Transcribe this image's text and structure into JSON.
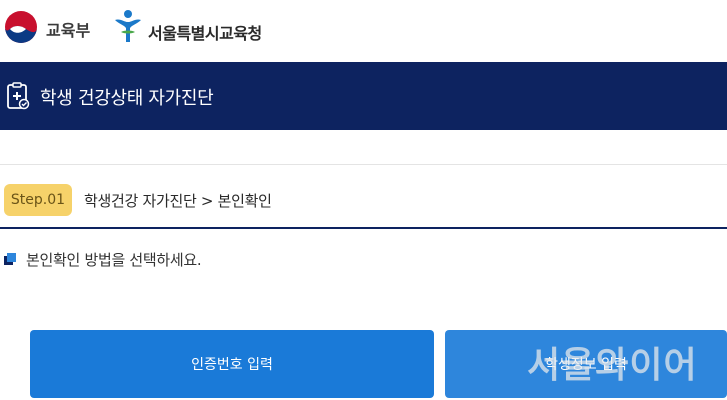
{
  "header": {
    "ministry_label": "교육부",
    "office_label": "서울특별시교육청",
    "colors": {
      "moe_red": "#c8102e",
      "moe_blue": "#0b3a84",
      "sen_blue": "#1b79c9",
      "sen_green": "#4aa84a"
    }
  },
  "title_bar": {
    "icon": "health-check-clipboard-icon",
    "title": "학생 건강상태 자가진단",
    "background": "#0d2360"
  },
  "step": {
    "badge": "Step.01",
    "path": "학생건강 자가진단 > 본인확인",
    "badge_color": "#f6d26a"
  },
  "instruction": {
    "bullet_icon": "square-bullet-icon",
    "text": "본인확인 방법을 선택하세요."
  },
  "buttons": {
    "certificate_number": "인증번호 입력",
    "student_info": "학생정보 입력",
    "color": "#1a7ad8"
  },
  "watermark": {
    "main": "서울와이어"
  }
}
